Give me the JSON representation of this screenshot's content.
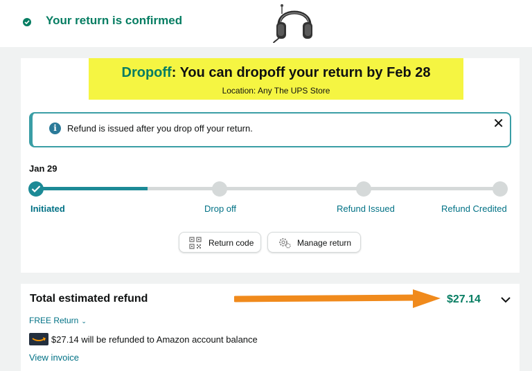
{
  "header": {
    "confirm_text": "Your return is confirmed",
    "product_image": "headphones-image"
  },
  "dropoff": {
    "keyword": "Dropoff",
    "message": ": You can dropoff your return by Feb 28",
    "location": "Location: Any The UPS Store"
  },
  "alert": {
    "text": "Refund is issued after you drop off your return.",
    "close_symbol": "✕"
  },
  "progress": {
    "date": "Jan 29",
    "completed_fraction": 0.24,
    "steps": [
      {
        "label": "Initiated",
        "done": true
      },
      {
        "label": "Drop off",
        "done": false
      },
      {
        "label": "Refund Issued",
        "done": false
      },
      {
        "label": "Refund Credited",
        "done": false
      }
    ]
  },
  "actions": {
    "return_code_label": "Return code",
    "manage_return_label": "Manage return"
  },
  "refund": {
    "title": "Total estimated refund",
    "amount": "$27.14",
    "free_return_label": "FREE Return",
    "balance_text": "$27.14 will be refunded to Amazon account balance",
    "view_invoice_label": "View invoice"
  },
  "colors": {
    "accent_green": "#067d62",
    "highlight_yellow": "#f5f542",
    "progress_teal": "#1c8a96",
    "link_blue": "#007185",
    "arrow_orange": "#f08a1c"
  }
}
